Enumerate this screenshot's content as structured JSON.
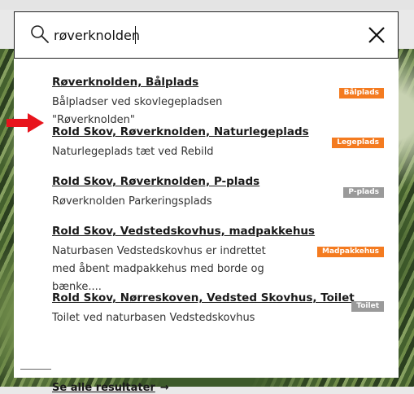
{
  "search": {
    "query": "røverknolden"
  },
  "results": [
    {
      "title": "Røverknolden, Bålplads",
      "description": "Bålpladser ved skovlegepladsen \"Røverknolden\"",
      "badge": "Bålplads",
      "badge_color": "#f47b20"
    },
    {
      "title": "Rold Skov, Røverknolden, Naturlegeplads",
      "description": "Naturlegeplads tæt ved Rebild",
      "badge": "Legeplads",
      "badge_color": "#f47b20"
    },
    {
      "title": "Rold Skov, Røverknolden, P-plads",
      "description": "Røverknolden Parkeringsplads",
      "badge": "P-plads",
      "badge_color": "#9a9a9a"
    },
    {
      "title": "Rold Skov, Vedstedskovhus, madpakkehus",
      "description": "Naturbasen Vedstedskovhus er indrettet med åbent madpakkehus med borde og bænke....",
      "badge": "Madpakkehus",
      "badge_color": "#f47b20"
    },
    {
      "title": "Rold Skov, Nørreskoven, Vedsted Skovhus, Toilet",
      "description": "Toilet ved naturbasen Vedstedskovhus",
      "badge": "Toilet",
      "badge_color": "#9a9a9a"
    }
  ],
  "see_all": {
    "label": "Se alle resultater",
    "arrow": "→"
  },
  "icons": {
    "search": "search-icon",
    "close": "close-icon",
    "highlight": "red-arrow-icon"
  }
}
